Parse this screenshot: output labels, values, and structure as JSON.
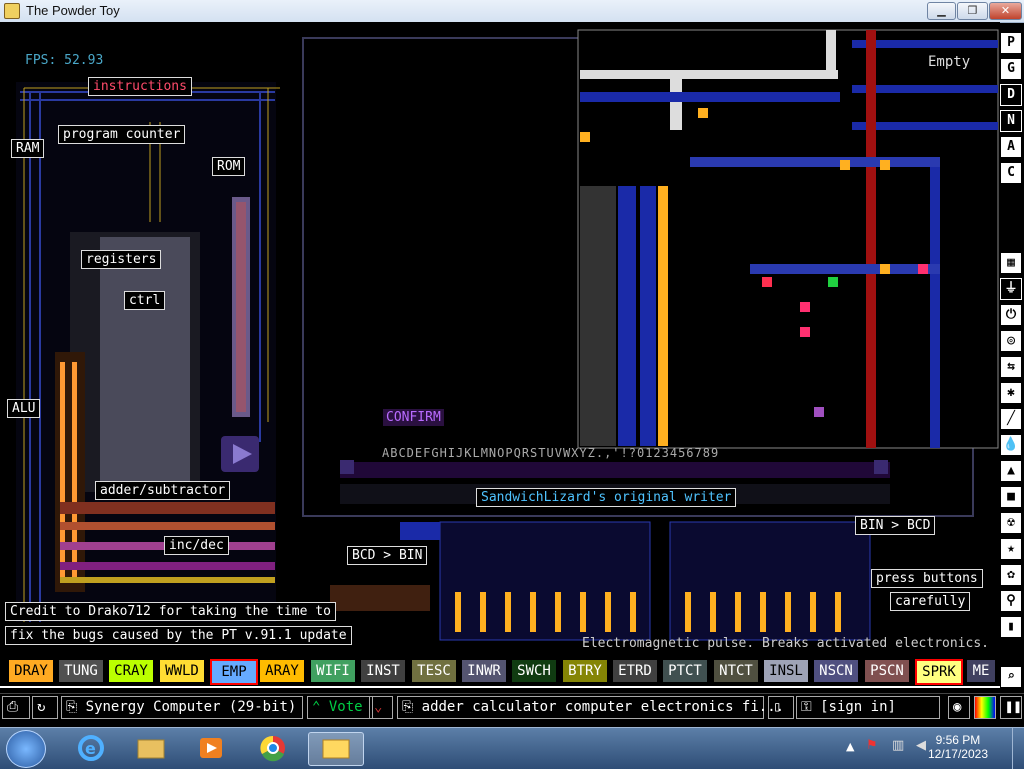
{
  "window": {
    "title": "The Powder Toy"
  },
  "game": {
    "fps": "FPS: 52.93",
    "labels": {
      "instructions": "instructions",
      "program_counter": "program counter",
      "ram": "RAM",
      "rom": "ROM",
      "registers": "registers",
      "ctrl": "ctrl",
      "alu": "ALU",
      "adder": "adder/subtractor",
      "incdec": "inc/dec",
      "bcd_bin": "BCD > BIN",
      "bin_bcd": "BIN > BCD",
      "press": "press buttons",
      "carefully": "carefully",
      "credit1": "Credit to Drako712 for taking the time to",
      "credit2": "fix the bugs caused by the PT v.91.1 update",
      "writer": "SandwichLizard's original writer",
      "confirm": "CONFIRM",
      "alphabet": "ABCDEFGHIJKLMNOPQRSTUVWXYZ.,'!?0123456789",
      "empty": "Empty",
      "tooltip": "Electromagnetic pulse. Breaks activated electronics."
    }
  },
  "sidebar": [
    "P",
    "G",
    "D",
    "N",
    "A",
    "C"
  ],
  "elements": [
    {
      "name": "DRAY",
      "bg": "#ffaa22",
      "fg": "#000"
    },
    {
      "name": "TUNG",
      "bg": "#505050",
      "fg": "#fff"
    },
    {
      "name": "CRAY",
      "bg": "#bbff00",
      "fg": "#000"
    },
    {
      "name": "WWLD",
      "bg": "#ffdd33",
      "fg": "#000"
    },
    {
      "name": "EMP",
      "bg": "#66aaff",
      "fg": "#000",
      "selected": true
    },
    {
      "name": "ARAY",
      "bg": "#ffbb00",
      "fg": "#000"
    },
    {
      "name": "WIFI",
      "bg": "#40a060",
      "fg": "#fff"
    },
    {
      "name": "INST",
      "bg": "#404040",
      "fg": "#fff"
    },
    {
      "name": "TESC",
      "bg": "#707040",
      "fg": "#fff"
    },
    {
      "name": "INWR",
      "bg": "#545470",
      "fg": "#fff"
    },
    {
      "name": "SWCH",
      "bg": "#103b11",
      "fg": "#fff"
    },
    {
      "name": "BTRY",
      "bg": "#858505",
      "fg": "#fff"
    },
    {
      "name": "ETRD",
      "bg": "#404040",
      "fg": "#fff"
    },
    {
      "name": "PTCT",
      "bg": "#405050",
      "fg": "#fff"
    },
    {
      "name": "NTCT",
      "bg": "#505040",
      "fg": "#fff"
    },
    {
      "name": "INSL",
      "bg": "#9ea3b6",
      "fg": "#000"
    },
    {
      "name": "NSCN",
      "bg": "#505080",
      "fg": "#fff"
    },
    {
      "name": "PSCN",
      "bg": "#805050",
      "fg": "#fff"
    },
    {
      "name": "SPRK",
      "bg": "#ffff80",
      "fg": "#000",
      "red_border": true
    },
    {
      "name": "ME",
      "bg": "#404060",
      "fg": "#fff"
    }
  ],
  "bottombar": {
    "save_name": "Synergy Computer (29-bit)",
    "vote": "Vote",
    "tags": "adder calculator computer electronics fi...",
    "sign_in": "[sign in]"
  },
  "taskbar": {
    "time": "9:56 PM",
    "date": "12/17/2023"
  }
}
